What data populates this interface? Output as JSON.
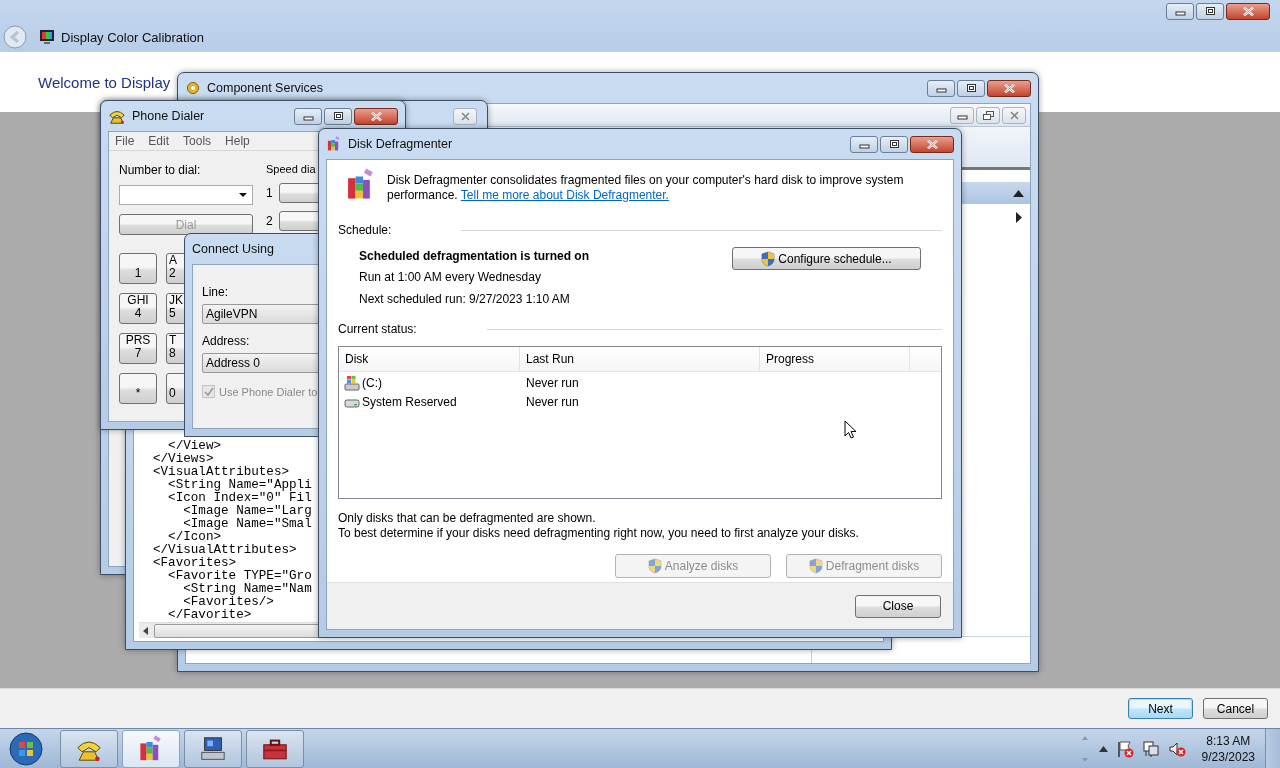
{
  "calibration_window": {
    "title": "Display Color Calibration",
    "heading": "Welcome to Display",
    "buttons": [
      {
        "label": "Next",
        "default": true
      },
      {
        "label": "Cancel",
        "default": false
      }
    ]
  },
  "component_services": {
    "title": "Component Services"
  },
  "xml_view": {
    "lines": [
      "  </View>",
      "</Views>",
      "<VisualAttributes>",
      "  <String Name=\"Appli",
      "  <Icon Index=\"0\" Fil",
      "    <Image Name=\"Larg",
      "    <Image Name=\"Smal",
      "  </Icon>",
      "</VisualAttributes>",
      "<Favorites>",
      "  <Favorite TYPE=\"Gro",
      "    <String Name=\"Nam",
      "    <Favorites/>",
      "  </Favorite>"
    ]
  },
  "phone_dialer": {
    "title": "Phone Dialer",
    "menu": [
      "File",
      "Edit",
      "Tools",
      "Help"
    ],
    "number_label": "Number to dial:",
    "dial_button": {
      "label": "Dial",
      "disabled": true
    },
    "speed_dial_label": "Speed dia",
    "speed_dial": [
      "1",
      "2"
    ],
    "keys": [
      {
        "digit": "1"
      },
      {
        "letters": "GHI",
        "digit": "4"
      },
      {
        "letters": "PRS",
        "digit": "7"
      },
      {
        "digit": "*"
      },
      {
        "letters": "A",
        "digit": "2"
      },
      {
        "letters": "JK",
        "digit": "5"
      },
      {
        "letters": "T",
        "digit": "8"
      },
      {
        "digit": "0"
      }
    ]
  },
  "connect_using": {
    "title": "Connect Using",
    "line_label": "Line:",
    "line_value": "AgileVPN",
    "address_label": "Address:",
    "address_value": "Address 0",
    "checkbox": {
      "label": "Use Phone Dialer to",
      "checked": true,
      "disabled": true
    }
  },
  "defragmenter": {
    "title": "Disk Defragmenter",
    "description": "Disk Defragmenter consolidates fragmented files on your computer's hard disk to improve system performance.",
    "link": "Tell me more about Disk Defragmenter.",
    "schedule_label": "Schedule:",
    "schedule_status": "Scheduled defragmentation is turned on",
    "schedule_time": "Run at 1:00 AM every Wednesday",
    "next_run": "Next scheduled run: 9/27/2023 1:10 AM",
    "configure_button": "Configure schedule...",
    "status_label": "Current status:",
    "table": {
      "columns": [
        "Disk",
        "Last Run",
        "Progress"
      ],
      "rows": [
        {
          "kind": "system",
          "disk": "(C:)",
          "last_run": "Never run"
        },
        {
          "kind": "drive",
          "disk": "System Reserved",
          "last_run": "Never run"
        }
      ]
    },
    "notes": [
      "Only disks that can be defragmented are shown.",
      "To best determine if your disks need defragmenting right now, you need to first analyze your disks."
    ],
    "actions": [
      {
        "label": "Analyze disks",
        "disabled": true
      },
      {
        "label": "Defragment disks",
        "disabled": true
      }
    ],
    "close_button": "Close"
  },
  "taskbar": {
    "apps": [
      {
        "kind": "phone",
        "selected": false
      },
      {
        "kind": "defrag",
        "selected": true
      },
      {
        "kind": "computer",
        "selected": false
      },
      {
        "kind": "toolbox",
        "selected": false
      }
    ],
    "time": "8:13 AM",
    "date": "9/23/2023"
  }
}
